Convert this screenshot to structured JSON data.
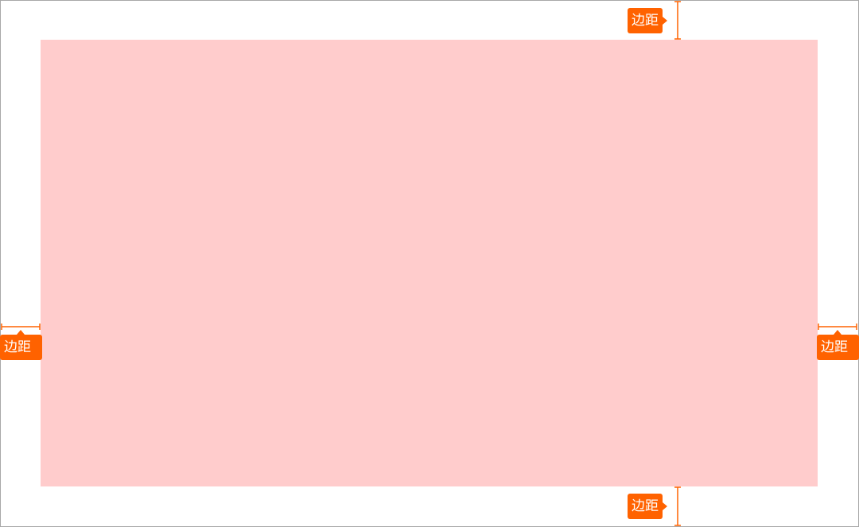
{
  "accent_color": "#ff6200",
  "content_color": "#ffcccc",
  "frame_color": "#a8a8a8",
  "margin_tags": {
    "top": "边距",
    "bottom": "边距",
    "left": "边距",
    "right": "边距"
  }
}
